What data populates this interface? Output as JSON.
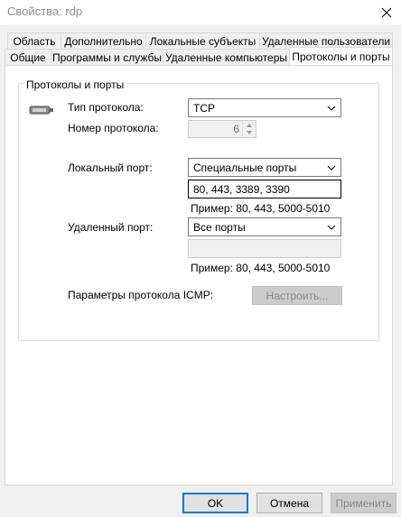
{
  "window": {
    "title": "Свойства: rdp"
  },
  "tabs_row1": [
    {
      "label": "Область"
    },
    {
      "label": "Дополнительно"
    },
    {
      "label": "Локальные субъекты"
    },
    {
      "label": "Удаленные пользователи"
    }
  ],
  "tabs_row2": [
    {
      "label": "Общие"
    },
    {
      "label": "Программы и службы"
    },
    {
      "label": "Удаленные компьютеры"
    },
    {
      "label": "Протоколы и порты"
    }
  ],
  "active_tab": "Протоколы и порты",
  "group": {
    "title": "Протоколы и порты",
    "protocol_type_label": "Тип протокола:",
    "protocol_type_value": "TCP",
    "protocol_number_label": "Номер протокола:",
    "protocol_number_value": "6",
    "local_port_label": "Локальный порт:",
    "local_port_mode": "Специальные порты",
    "local_port_value": "80, 443, 3389, 3390",
    "local_port_example": "Пример: 80, 443, 5000-5010",
    "remote_port_label": "Удаленный порт:",
    "remote_port_mode": "Все порты",
    "remote_port_value": "",
    "remote_port_example": "Пример: 80, 443, 5000-5010",
    "icmp_label": "Параметры протокола ICMP:",
    "icmp_button": "Настроить..."
  },
  "footer": {
    "ok": "OK",
    "cancel": "Отмена",
    "apply": "Применить"
  },
  "colors": {
    "accent": "#0078d7",
    "panel": "#ffffff",
    "background": "#f0f0f0"
  }
}
